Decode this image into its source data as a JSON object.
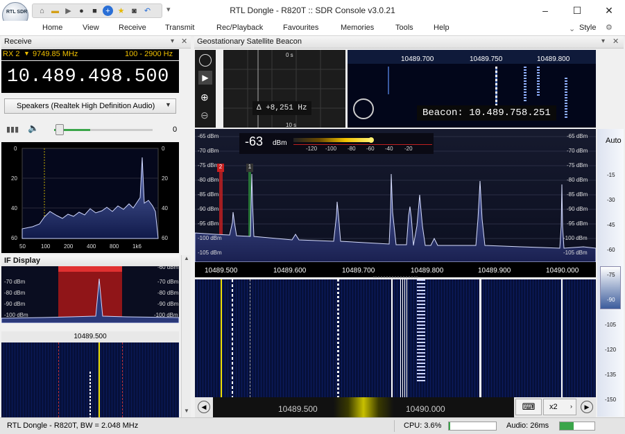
{
  "app": {
    "title": "RTL Dongle - R820T :: SDR Console v3.0.21",
    "orb_label": "RTL SDR"
  },
  "window": {
    "minimize": "–",
    "maximize": "☐",
    "close": "✕"
  },
  "quick_access": [
    "home-icon",
    "folder-icon",
    "play-icon",
    "record-icon",
    "stop-icon",
    "add-icon",
    "favourite-icon",
    "camera-icon",
    "undo-icon"
  ],
  "menu": {
    "items": [
      "Home",
      "View",
      "Receive",
      "Transmit",
      "Rec/Playback",
      "Favourites",
      "Memories",
      "Tools",
      "Help"
    ],
    "style_label": "Style"
  },
  "receive": {
    "header": "Receive",
    "rx_label": "RX 2",
    "lo_freq": "9749.85 MHz",
    "bandwidth": "100 - 2900 Hz",
    "frequency": "10.489.498.500",
    "audio_device": "Speakers (Realtek High Definition Audio)",
    "volume_value": "0",
    "audio_spectrum": {
      "y_labels": [
        "0",
        "20",
        "40",
        "60"
      ],
      "x_labels": [
        "50",
        "100",
        "200",
        "400",
        "800",
        "1k6"
      ]
    }
  },
  "if_display": {
    "header": "IF Display",
    "db_labels": [
      "-60 dBm",
      "-70 dBm",
      "-80 dBm",
      "-90 dBm",
      "-100 dBm"
    ],
    "freq_label": "10489.500"
  },
  "main": {
    "header": "Geostationary Satellite Beacon",
    "scope": {
      "time_label": "0 s",
      "delta": "Δ +8,251 Hz",
      "bottom_label": "10 s"
    },
    "top_spectrum_freqs": [
      "10489.700",
      "10489.750",
      "10489.800"
    ],
    "beacon": "Beacon: 10.489.758.251",
    "smeter": {
      "value": "-63",
      "unit": "dBm",
      "scale": [
        "-120",
        "-100",
        "-80",
        "-60",
        "-40",
        "-20"
      ]
    },
    "db_labels": [
      "-65 dBm",
      "-70 dBm",
      "-75 dBm",
      "-80 dBm",
      "-85 dBm",
      "-90 dBm",
      "-95 dBm",
      "-100 dBm",
      "-105 dBm"
    ],
    "freq_axis": [
      "10489.500",
      "10489.600",
      "10489.700",
      "10489.800",
      "10489.900",
      "10490.000"
    ],
    "markers": [
      "2",
      "1"
    ],
    "auto_label": "Auto",
    "right_scale": [
      "-15",
      "-30",
      "-45",
      "-60",
      "-75",
      "-90",
      "-105",
      "-120",
      "-135",
      "-150"
    ],
    "nav_freqs": [
      "10489.500",
      "10490.000"
    ],
    "zoom_label": "x2"
  },
  "status": {
    "device": "RTL Dongle - R820T, BW = 2.048 MHz",
    "cpu": "CPU: 3.6%",
    "audio": "Audio: 26ms",
    "cpu_fraction": 0.036,
    "audio_fraction": 0.4
  },
  "colors": {
    "accent": "#f0c000",
    "trace": "#cfd7ff",
    "waterfall": "#06103a"
  }
}
